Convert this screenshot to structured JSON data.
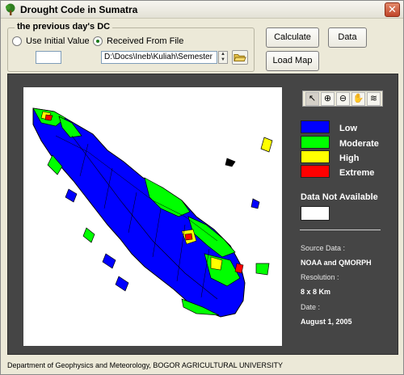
{
  "window": {
    "title": "Drought Code in Sumatra"
  },
  "previous_dc": {
    "group_label": "the previous day's DC",
    "option_initial": "Use Initial Value",
    "option_file": "Received From File",
    "selected": "Received From File",
    "initial_value": "",
    "file_path": "D:\\Docs\\Ineb\\Kuliah\\Semester"
  },
  "buttons": {
    "calculate": "Calculate",
    "data": "Data",
    "load_map": "Load Map"
  },
  "toolbar": {
    "tools": [
      "pointer-icon",
      "zoom-in-icon",
      "zoom-out-icon",
      "pan-hand-icon",
      "layers-icon"
    ]
  },
  "legend": {
    "items": [
      {
        "label": "Low",
        "color": "#0000ff"
      },
      {
        "label": "Moderate",
        "color": "#00ff00"
      },
      {
        "label": "High",
        "color": "#ffff00"
      },
      {
        "label": "Extreme",
        "color": "#ff0000"
      }
    ],
    "not_available_label": "Data Not Available",
    "not_available_color": "#ffffff"
  },
  "info": {
    "source_label": "Source Data :",
    "source_value": "NOAA and QMORPH",
    "resolution_label": "Resolution :",
    "resolution_value": "8 x 8 Km",
    "date_label": "Date :",
    "date_value": "August 1, 2005"
  },
  "status": {
    "text": "Department of Geophysics and Meteorology, BOGOR AGRICULTURAL UNIVERSITY"
  },
  "colors": {
    "panel_background": "#454545",
    "window_background": "#ece9d8"
  }
}
